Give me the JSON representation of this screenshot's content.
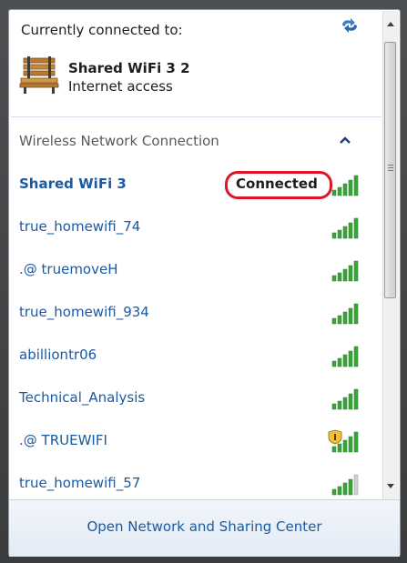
{
  "current": {
    "label": "Currently connected to:",
    "network_name": "Shared WiFi 3  2",
    "status": "Internet access"
  },
  "group": {
    "title": "Wireless Network Connection"
  },
  "networks": [
    {
      "name": "Shared WiFi 3",
      "badge": "Connected",
      "signal_bars": 5,
      "secured_shield": false
    },
    {
      "name": "true_homewifi_74",
      "signal_bars": 5,
      "secured_shield": false
    },
    {
      "name": ".@ truemoveH",
      "signal_bars": 5,
      "secured_shield": false
    },
    {
      "name": "true_homewifi_934",
      "signal_bars": 5,
      "secured_shield": false
    },
    {
      "name": "abilliontr06",
      "signal_bars": 5,
      "secured_shield": false
    },
    {
      "name": "Technical_Analysis",
      "signal_bars": 5,
      "secured_shield": false
    },
    {
      "name": ".@ TRUEWIFI",
      "signal_bars": 5,
      "secured_shield": true
    },
    {
      "name": "true_homewifi_57",
      "signal_bars": 4,
      "secured_shield": false
    }
  ],
  "footer": {
    "link": "Open Network and Sharing Center"
  },
  "colors": {
    "link_blue": "#1a5aa0",
    "signal_green": "#3aa43a",
    "highlight_red": "#e0142b"
  },
  "icons": {
    "refresh": "refresh-icon",
    "connection": "bench-icon",
    "collapse": "chevron-up-icon",
    "signal": "wifi-signal-icon",
    "shield": "shield-icon"
  }
}
